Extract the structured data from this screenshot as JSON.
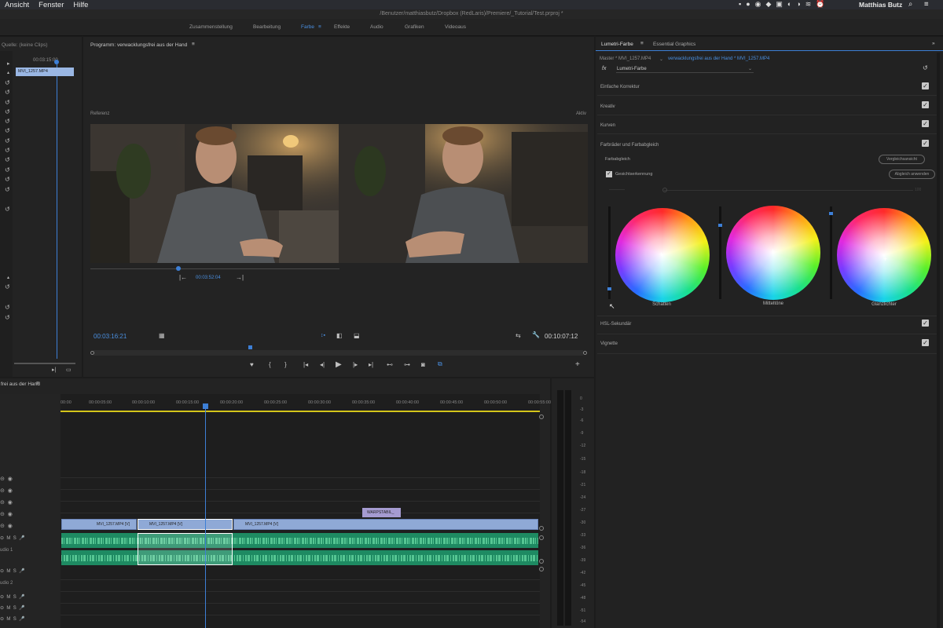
{
  "menubar": {
    "items": [
      "Ansicht",
      "Fenster",
      "Hilfe"
    ],
    "user": "Matthias Butz"
  },
  "title_path": "/Benutzer/matthiasbutz/Dropbox (RedLaris)/Premiere/_Tutorial/Test.prproj *",
  "workspaces": {
    "tabs": [
      "Zusammenstellung",
      "Bearbeitung",
      "Farbe",
      "Effekte",
      "Audio",
      "Grafiken",
      "Videoaus"
    ],
    "active": "Farbe"
  },
  "source_panel": {
    "title": "Quelle: (keine Clips)",
    "timecode": "00:03:15:00",
    "clip_label": "MVI_1257.MP4"
  },
  "program_monitor": {
    "title": "Programm: verwacklungsfrei aus der Hand",
    "left_label": "Referenz",
    "right_label": "Aktiv",
    "ref_timecode": "00:03:52:04",
    "current_timecode": "00:03:16:21",
    "duration": "00:10:07:12"
  },
  "timeline": {
    "tab": "frei aus der Hand",
    "ruler": [
      "00:00",
      "00:00:05:00",
      "00:00:10:00",
      "00:00:15:00",
      "00:00:20:00",
      "00:00:25:00",
      "00:00:30:00",
      "00:00:35:00",
      "00:00:40:00",
      "00:00:45:00",
      "00:00:50:00",
      "00:00:55:00"
    ],
    "clips": [
      "MVI_1257.MP4 [V]",
      "MVI_1257.MP4 [V]",
      "MVI_1257.MP4 [V]"
    ],
    "title_clip": "WARPSTABIL_",
    "audio_label_1": "udio 1",
    "audio_label_2": "udio 2"
  },
  "meter": {
    "labels": [
      "0",
      "-3",
      "-6",
      "-9",
      "-12",
      "-15",
      "-18",
      "-21",
      "-24",
      "-27",
      "-30",
      "-33",
      "-36",
      "-39",
      "-42",
      "-45",
      "-48",
      "-51",
      "-54"
    ]
  },
  "lumetri": {
    "tab_active": "Lumetri-Farbe",
    "tab_other": "Essential Graphics",
    "master_label": "Master * MVI_1257.MP4",
    "sequence_label": "verwacklungsfrei aus der Hand * MVI_1257.MP4",
    "fx_label": "Lumetri-Farbe",
    "sections": {
      "basic": "Einfache Korrektur",
      "creative": "Kreativ",
      "curves": "Kurven",
      "wheels": "Farbräder und Farbabgleich",
      "hsl": "HSL-Sekundär",
      "vignette": "Vignette"
    },
    "color_match": "Farbabgleich",
    "compare_btn": "Vergleichsansicht",
    "apply_btn": "Abgleich anwenden",
    "face_detect": "Gesichtserkennung",
    "face_detect_checked": true,
    "wheels": [
      "Schatten",
      "Mitteltöne",
      "Glanzlichter"
    ],
    "slider_value": "100"
  }
}
